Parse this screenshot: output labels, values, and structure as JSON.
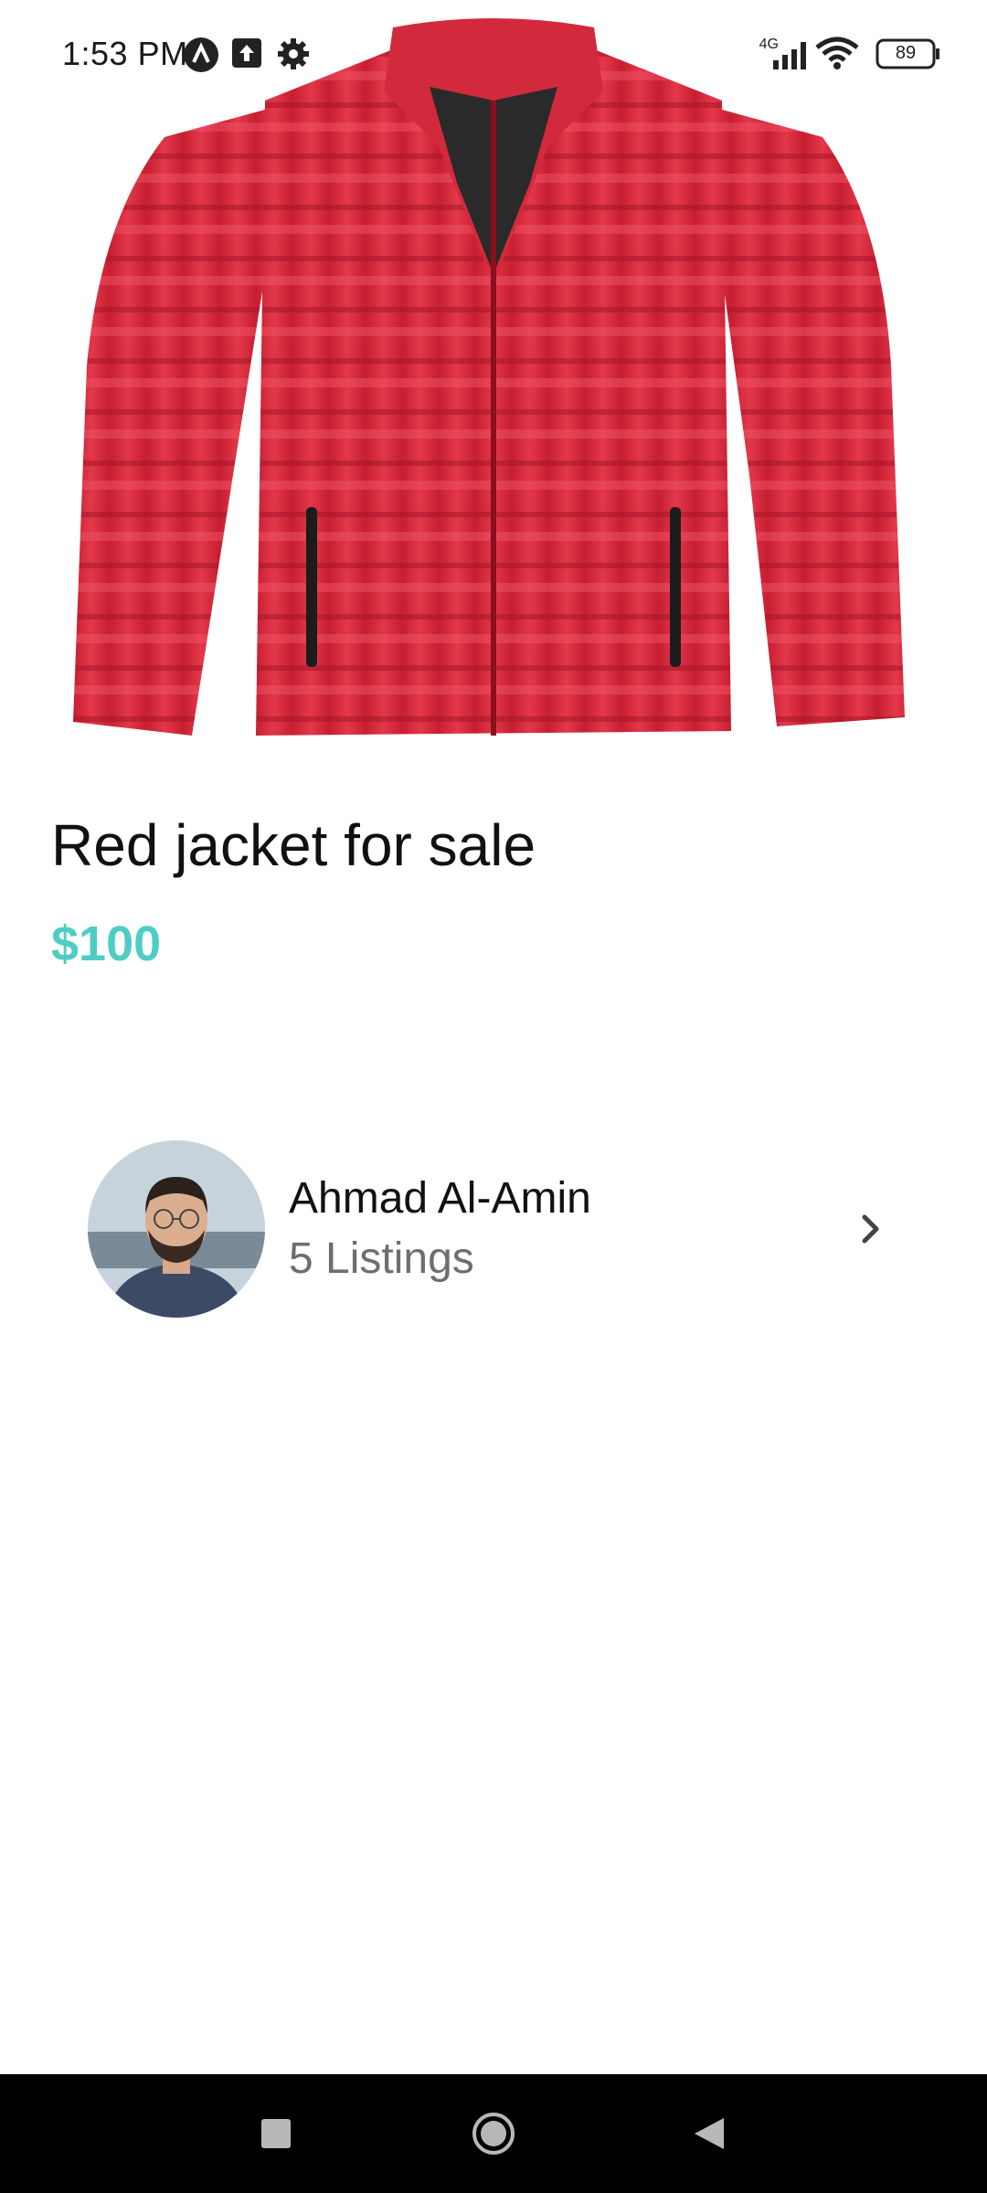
{
  "status_bar": {
    "time": "1:53 PM",
    "network": "4G",
    "battery": "89",
    "icons": [
      "app-a-icon",
      "upload-icon",
      "gear-icon",
      "signal-icon",
      "wifi-icon",
      "battery-icon"
    ]
  },
  "product": {
    "title": "Red jacket for sale",
    "price": "$100",
    "image": "red-puffer-jacket-image"
  },
  "seller": {
    "name": "Ahmad Al-Amin",
    "listings": "5 Listings",
    "avatar": "seller-avatar-photo"
  },
  "nav_bar": {
    "buttons": [
      "recents-icon",
      "home-icon",
      "back-icon"
    ]
  },
  "colors": {
    "price": "#4ecdc4",
    "jacket": "#d9283b",
    "nav_bar": "#000000"
  }
}
